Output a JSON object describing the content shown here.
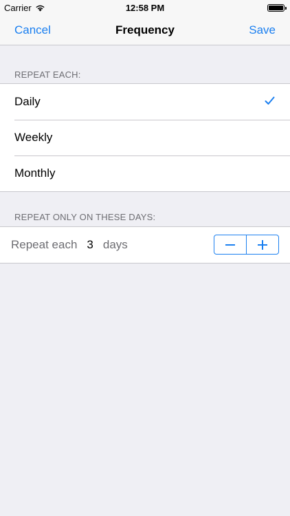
{
  "status_bar": {
    "carrier": "Carrier",
    "time": "12:58 PM"
  },
  "nav": {
    "cancel_label": "Cancel",
    "title": "Frequency",
    "save_label": "Save"
  },
  "repeat_each": {
    "header": "REPEAT EACH:",
    "options": [
      "Daily",
      "Weekly",
      "Monthly"
    ],
    "selected": "Daily"
  },
  "repeat_days": {
    "header": "REPEAT ONLY ON THESE DAYS:",
    "label": "Repeat each",
    "count": "3",
    "unit": "days"
  },
  "colors": {
    "accent": "#1a7ff0",
    "background": "#efeff4",
    "secondary_text": "#6d6d72"
  }
}
